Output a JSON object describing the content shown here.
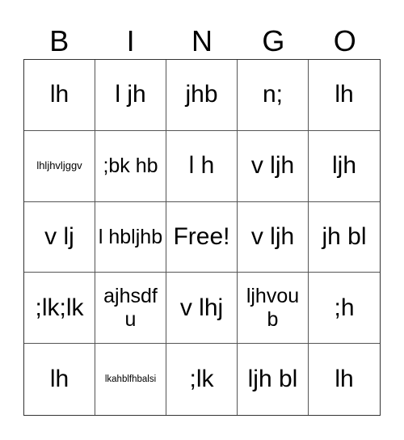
{
  "title_letters": [
    "B",
    "I",
    "N",
    "G",
    "O"
  ],
  "board": {
    "rows": [
      [
        "lh",
        "l jh",
        "jhb",
        "n;",
        "lh"
      ],
      [
        "lhljhvljggv",
        ";bk hb",
        "l h",
        "v ljh",
        "ljh"
      ],
      [
        "v lj",
        "l hbljhb",
        "Free!",
        "v ljh",
        "jh bl"
      ],
      [
        ";lk;lk",
        "ajhsdf u",
        "v lhj",
        "ljhvou b",
        ";h"
      ],
      [
        "lh",
        "lkahblfhbalsi",
        ";lk",
        "ljh bl",
        "lh"
      ]
    ],
    "free_space": "Free!"
  },
  "colors": {
    "grid_line": "#555555",
    "border": "#333333",
    "text": "#000000",
    "background": "#ffffff"
  }
}
